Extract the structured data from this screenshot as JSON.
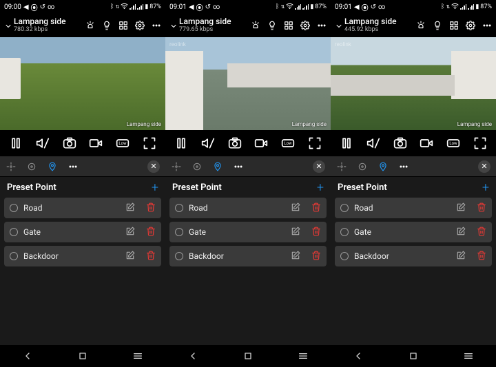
{
  "battery": "87%",
  "screens": [
    {
      "time": "09:00",
      "camera_name": "Lampang side",
      "kbps": "780.32 kbps",
      "preview_variant": "p1"
    },
    {
      "time": "09:01",
      "camera_name": "Lampang side",
      "kbps": "779.65 kbps",
      "preview_variant": "p2"
    },
    {
      "time": "09:01",
      "camera_name": "Lampang side",
      "kbps": "445.92 kbps",
      "preview_variant": "p3"
    }
  ],
  "watermark_brand": "reolink",
  "preset": {
    "title": "Preset Point",
    "items": [
      {
        "label": "Road"
      },
      {
        "label": "Gate"
      },
      {
        "label": "Backdoor"
      }
    ]
  },
  "icons": {
    "status_plane": "✈",
    "status_fb": "f",
    "status_link": "∞"
  }
}
